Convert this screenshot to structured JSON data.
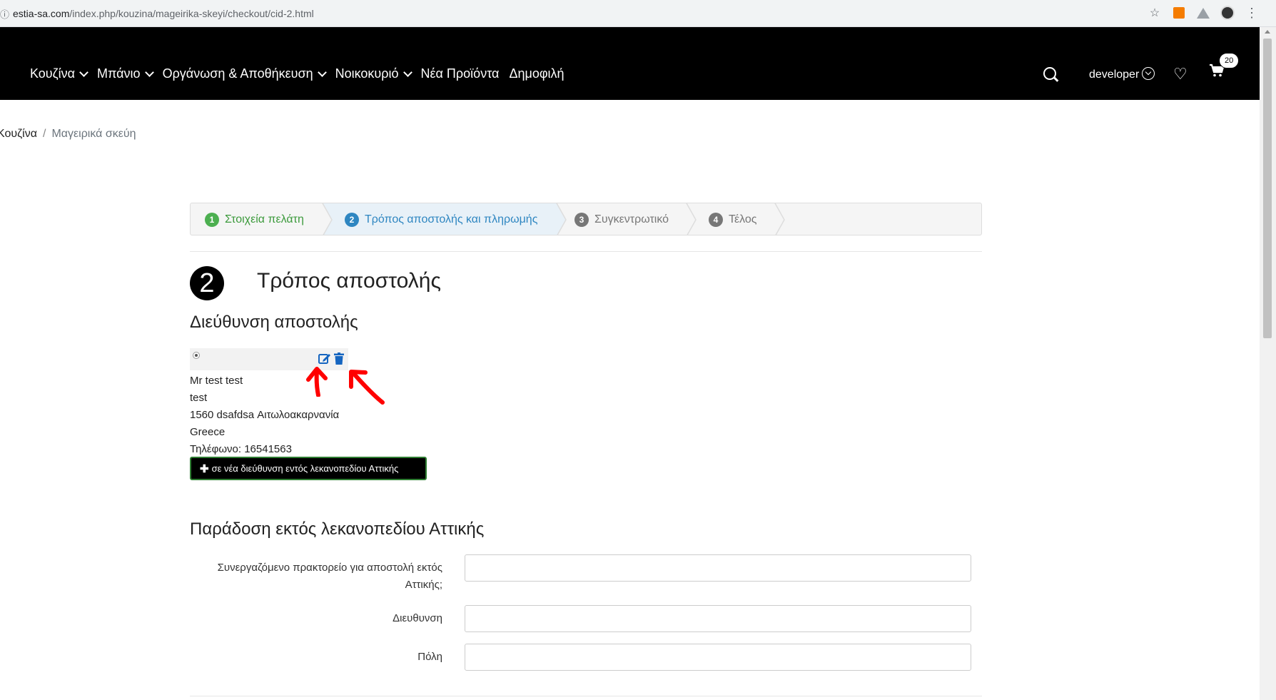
{
  "browser": {
    "url_domain": "estia-sa.com",
    "url_path": "/index.php/kouzina/mageirika-skeyi/checkout/cid-2.html",
    "info_icon": "info-icon",
    "star_icon": "star-icon"
  },
  "header": {
    "nav": [
      {
        "label": "Κουζίνα",
        "has_dropdown": true
      },
      {
        "label": "Μπάνιο",
        "has_dropdown": true
      },
      {
        "label": "Οργάνωση & Αποθήκευση",
        "has_dropdown": true
      },
      {
        "label": "Νοικοκυριό",
        "has_dropdown": true
      },
      {
        "label": "Νέα Προϊόντα",
        "has_dropdown": false
      },
      {
        "label": "Δημοφιλή",
        "has_dropdown": false
      }
    ],
    "user": "developer",
    "cart_count": "20"
  },
  "breadcrumb": {
    "parent": "Κουζίνα",
    "separator": "/",
    "current": "Μαγειρικά σκεύη"
  },
  "steps": [
    {
      "num": "1",
      "label": "Στοιχεία πελάτη",
      "state": "done"
    },
    {
      "num": "2",
      "label": "Τρόπος αποστολής και πληρωμής",
      "state": "active"
    },
    {
      "num": "3",
      "label": "Συγκεντρωτικό",
      "state": "pending"
    },
    {
      "num": "4",
      "label": "Τέλος",
      "state": "pending"
    }
  ],
  "section": {
    "step_number": "2",
    "title": "Τρόπος αποστολής",
    "subtitle": "Διεύθυνση αποστολής"
  },
  "address": {
    "lines": [
      "Mr test test",
      "test",
      "1560 dsafdsa Αιτωλοακαρνανία",
      "Greece",
      "Τηλέφωνο: 16541563"
    ],
    "new_address_button": "σε νέα διεύθυνση εντός λεκανοπεδίου Αττικής"
  },
  "delivery": {
    "title": "Παράδοση εκτός λεκανοπεδίου Αττικής",
    "fields": [
      {
        "label": "Συνεργαζόμενο πρακτορείο για αποστολή εκτός Αττικής;",
        "value": ""
      },
      {
        "label": "Διευθυνση",
        "value": ""
      },
      {
        "label": "Πόλη",
        "value": ""
      }
    ]
  },
  "colors": {
    "header_bg": "#000000",
    "step_done": "#4caf50",
    "step_active": "#2e86c1",
    "icon_blue": "#1565c0",
    "annotation_red": "#ff0000"
  }
}
